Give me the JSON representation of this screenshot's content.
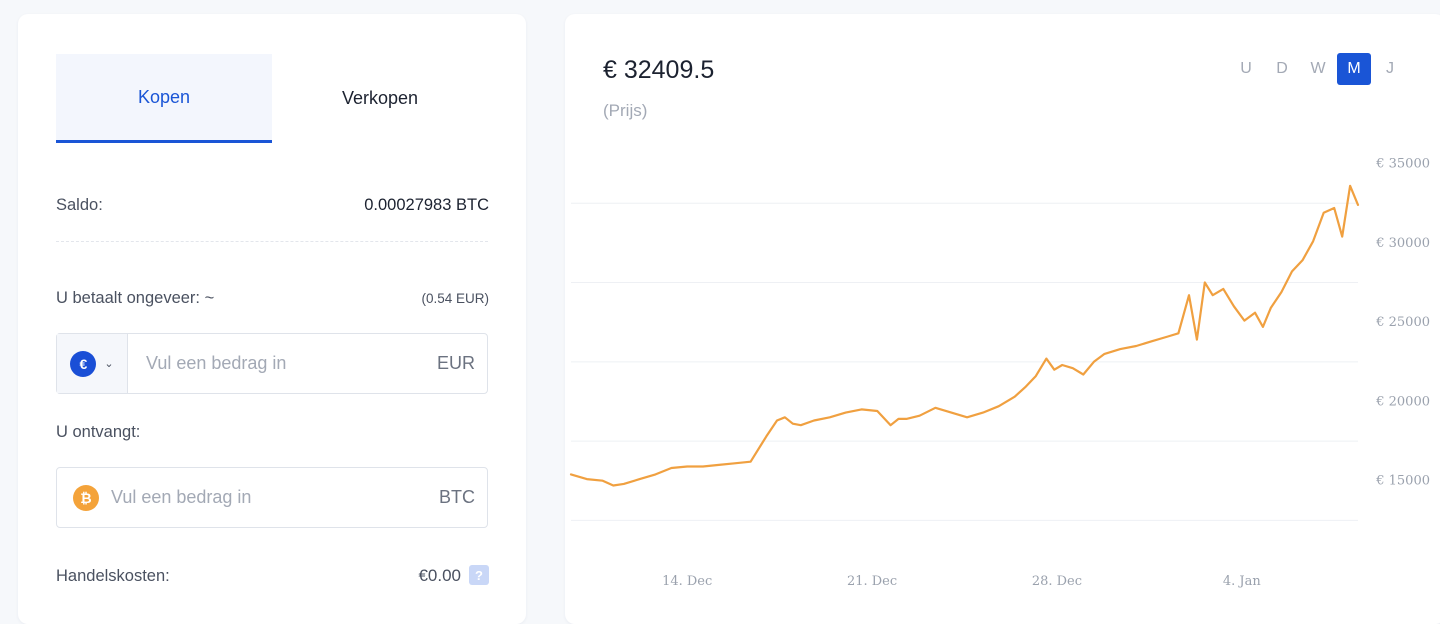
{
  "trade": {
    "tabs": [
      {
        "label": "Kopen",
        "active": true
      },
      {
        "label": "Verkopen",
        "active": false
      }
    ],
    "balance": {
      "label": "Saldo:",
      "value": "0.00027983 BTC"
    },
    "pay": {
      "label": "U betaalt ongeveer: ~",
      "approx": "(0.54 EUR)",
      "placeholder": "Vul een bedrag in",
      "unit": "EUR",
      "coin_icon": "euro-coin-icon",
      "coin_glyph": "€"
    },
    "receive": {
      "label": "U ontvangt:",
      "placeholder": "Vul een bedrag in",
      "unit": "BTC",
      "coin_icon": "bitcoin-coin-icon",
      "coin_glyph": "₿"
    },
    "fees": {
      "label": "Handelskosten:",
      "value": "€0.00",
      "help": "?"
    }
  },
  "chart_panel": {
    "price": "€ 32409.5",
    "price_sub": "(Prijs)",
    "periods": [
      {
        "label": "U",
        "active": false
      },
      {
        "label": "D",
        "active": false
      },
      {
        "label": "W",
        "active": false
      },
      {
        "label": "M",
        "active": true
      },
      {
        "label": "J",
        "active": false
      }
    ],
    "colors": {
      "line": "#f0a040",
      "accent": "#1a55d6",
      "grid": "#eef0f4"
    }
  },
  "chart_data": {
    "type": "line",
    "x_ticks": [
      "14. Dec",
      "21. Dec",
      "28. Dec",
      "4. Jan"
    ],
    "x_tick_days": [
      14,
      21,
      28,
      35
    ],
    "y_ticks": [
      "€ 15000",
      "€ 20000",
      "€ 25000",
      "€ 30000",
      "€ 35000"
    ],
    "y_tick_values": [
      15000,
      20000,
      25000,
      30000,
      35000
    ],
    "ylim": [
      10000,
      37500
    ],
    "xlim": [
      9.6,
      39.4
    ],
    "grid": true,
    "series": [
      {
        "x": [
          9.6,
          10.2,
          10.8,
          11.2,
          11.6,
          12.2,
          12.8,
          13.4,
          14.0,
          14.6,
          15.2,
          15.8,
          16.4,
          17.0,
          17.4,
          17.7,
          18.0,
          18.3,
          18.8,
          19.4,
          20.0,
          20.6,
          21.2,
          21.7,
          22.0,
          22.3,
          22.8,
          23.4,
          24.0,
          24.6,
          25.2,
          25.8,
          26.4,
          26.8,
          27.2,
          27.6,
          27.9,
          28.2,
          28.6,
          29.0,
          29.4,
          29.8,
          30.4,
          31.0,
          31.6,
          32.2,
          32.6,
          33.0,
          33.3,
          33.6,
          33.9,
          34.3,
          34.7,
          35.1,
          35.5,
          35.8,
          36.1,
          36.5,
          36.9,
          37.3,
          37.7,
          38.1,
          38.5,
          38.8,
          39.1,
          39.4
        ],
        "y": [
          15400,
          15100,
          15000,
          14700,
          14800,
          15100,
          15400,
          15800,
          15900,
          15900,
          16000,
          16100,
          16200,
          17800,
          18800,
          19000,
          18600,
          18500,
          18800,
          19000,
          19300,
          19500,
          19400,
          18500,
          18900,
          18900,
          19100,
          19600,
          19300,
          19000,
          19300,
          19700,
          20300,
          20900,
          21600,
          22700,
          22000,
          22300,
          22100,
          21700,
          22500,
          23000,
          23300,
          23500,
          23800,
          24100,
          24300,
          26700,
          23900,
          27500,
          26700,
          27100,
          26000,
          25100,
          25600,
          24700,
          25900,
          26900,
          28200,
          28900,
          30100,
          31900,
          32200,
          30400,
          33600,
          32400
        ]
      }
    ]
  }
}
